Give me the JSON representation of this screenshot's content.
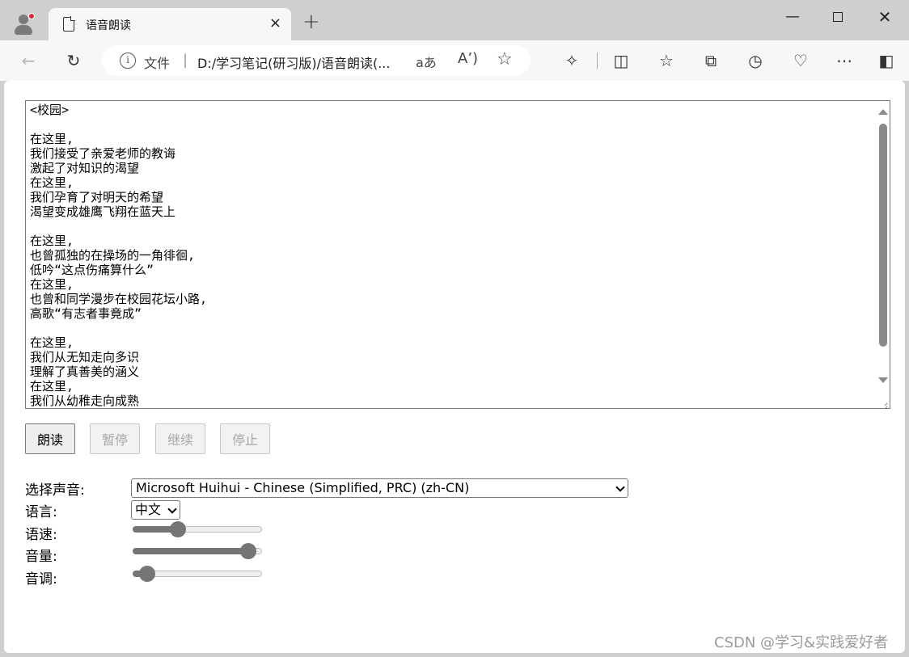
{
  "browser": {
    "tab_title": "语音朗读",
    "close_tab": "×",
    "new_tab": "+",
    "minimize": "—",
    "close_window": "✕",
    "address": {
      "info_icon": "i",
      "scheme_label": "文件",
      "separator": "|",
      "url": "D:/学习笔记(研习版)/语音朗读(...",
      "reader_mode": "aあ",
      "read_aloud": "A’)"
    }
  },
  "page": {
    "textarea_lines": "<校园>\n\n在这里,\n我们接受了亲爱老师的教诲\n激起了对知识的渴望\n在这里,\n我们孕育了对明天的希望\n渴望变成雄鹰飞翔在蓝天上\n\n在这里,\n也曾孤独的在操场的一角徘徊,\n低吟“这点伤痛算什么”\n在这里,\n也曾和同学漫步在校园花坛小路,\n高歌“有志者事竟成”\n\n在这里,\n我们从无知走向多识\n理解了真善美的涵义\n在这里,\n我们从幼稚走向成熟",
    "buttons": {
      "read": "朗读",
      "pause": "暂停",
      "resume": "继续",
      "stop": "停止"
    },
    "labels": {
      "voice": "选择声音:",
      "language": "语言:",
      "rate": "语速:",
      "volume": "音量:",
      "pitch": "音调:"
    },
    "voice_selected": "Microsoft Huihui - Chinese (Simplified, PRC) (zh-CN)",
    "language_selected": "中文",
    "sliders": {
      "rate": 0.33,
      "volume": 0.95,
      "pitch": 0.06
    }
  },
  "watermark": "CSDN @学习&实践爱好者",
  "colors": {
    "chrome_bg": "#cfcfcf",
    "toolbar_bg": "#f7f7f7",
    "slider_fill": "#757575"
  }
}
